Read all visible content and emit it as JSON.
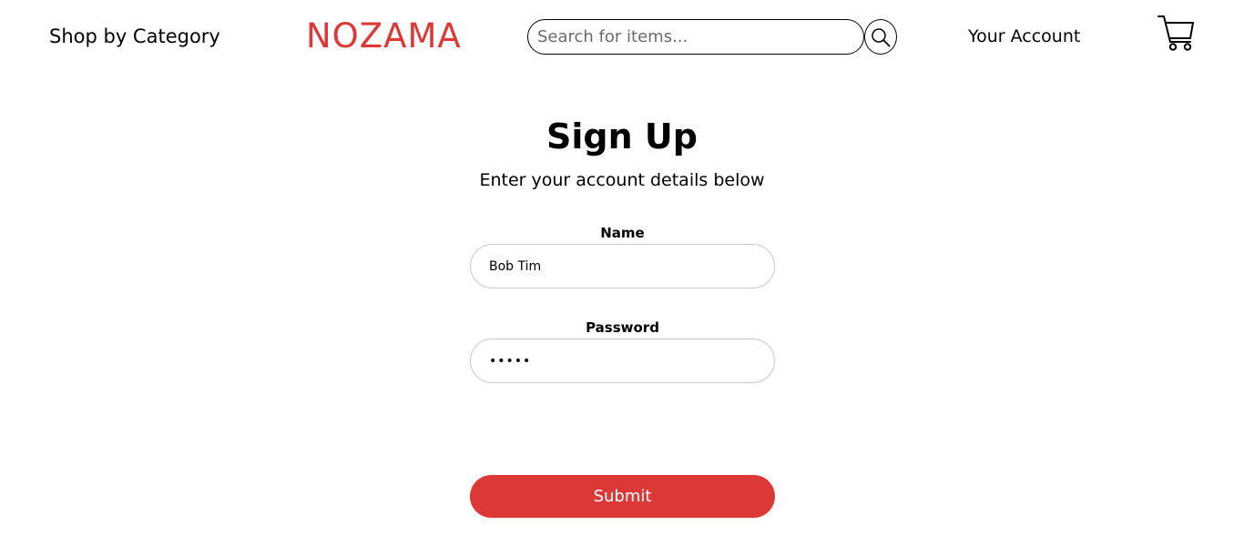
{
  "nav": {
    "category_label": "Shop by Category",
    "logo": "NOZAMA",
    "search_placeholder": "Search for items...",
    "search_icon": "magnifier",
    "account_label": "Your Account",
    "cart_icon": "shopping-cart"
  },
  "form": {
    "title": "Sign Up",
    "subtitle": "Enter your account details below",
    "name_label": "Name",
    "name_value": "Bob Tim",
    "password_label": "Password",
    "password_value": "•••••",
    "submit_label": "Submit"
  },
  "colors": {
    "accent": "#dc3838",
    "input_border": "#c9c9c9"
  }
}
